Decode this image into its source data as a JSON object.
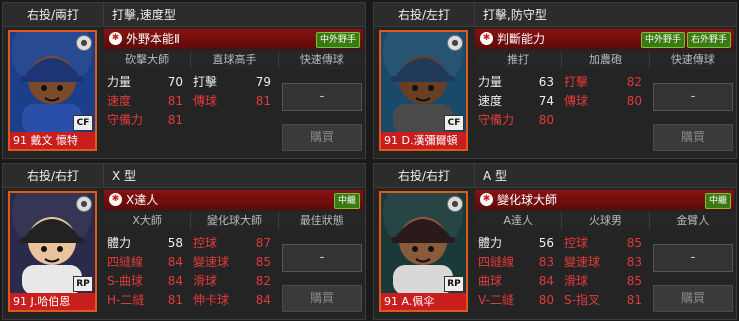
{
  "cards": [
    {
      "handedness": "右投/兩打",
      "player_type": "打擊,速度型",
      "portrait": {
        "number_name": "91 戴文 懷特",
        "position": "CF",
        "team_icon": "bat-ball-icon"
      },
      "ability": {
        "name": "外野本能Ⅱ",
        "icon": "red-star-icon",
        "position_badges": [
          "中外野手"
        ]
      },
      "sub_skills": [
        "砍擊大師",
        "直球高手",
        "快速傳球"
      ],
      "stats": [
        {
          "k1": "力量",
          "v1": "70",
          "k2": "打擊",
          "v2": "79",
          "c1": "w",
          "c2": "w"
        },
        {
          "k1": "速度",
          "v1": "81",
          "k2": "傳球",
          "v2": "81",
          "c1": "r",
          "c2": "r"
        },
        {
          "k1": "守備力",
          "v1": "81",
          "k2": "",
          "v2": "",
          "c1": "r",
          "c2": "r"
        }
      ],
      "slot_value": "-",
      "buy_label": "購買"
    },
    {
      "handedness": "右投/左打",
      "player_type": "打擊,防守型",
      "portrait": {
        "number_name": "91 D.漢彌爾頓",
        "position": "CF",
        "team_icon": "snowflake-icon"
      },
      "ability": {
        "name": "判斷能力",
        "icon": "blue-eye-icon",
        "position_badges": [
          "中外野手",
          "右外野手"
        ]
      },
      "sub_skills": [
        "推打",
        "加農砲",
        "快速傳球"
      ],
      "stats": [
        {
          "k1": "力量",
          "v1": "63",
          "k2": "打擊",
          "v2": "82",
          "c1": "w",
          "c2": "r"
        },
        {
          "k1": "速度",
          "v1": "74",
          "k2": "傳球",
          "v2": "80",
          "c1": "w",
          "c2": "r"
        },
        {
          "k1": "守備力",
          "v1": "80",
          "k2": "",
          "v2": "",
          "c1": "r",
          "c2": "r"
        }
      ],
      "slot_value": "-",
      "buy_label": "購買"
    },
    {
      "handedness": "右投/右打",
      "player_type": "X 型",
      "portrait": {
        "number_name": "91 J.哈伯恩",
        "position": "RP",
        "team_icon": "bat-ball-icon"
      },
      "ability": {
        "name": "X達人",
        "icon": "blue-x-icon",
        "position_badges": [
          "中繼"
        ]
      },
      "sub_skills": [
        "X大師",
        "變化球大師",
        "最佳狀態"
      ],
      "stats": [
        {
          "k1": "體力",
          "v1": "58",
          "k2": "控球",
          "v2": "87",
          "c1": "w",
          "c2": "r"
        },
        {
          "k1": "四縫線",
          "v1": "84",
          "k2": "變速球",
          "v2": "85",
          "c1": "r",
          "c2": "r"
        },
        {
          "k1": "S-曲球",
          "v1": "84",
          "k2": "滑球",
          "v2": "82",
          "c1": "r",
          "c2": "r"
        },
        {
          "k1": "H-二縫",
          "v1": "81",
          "k2": "伸卡球",
          "v2": "84",
          "c1": "r",
          "c2": "r"
        }
      ],
      "slot_value": "-",
      "buy_label": "購買"
    },
    {
      "handedness": "右投/右打",
      "player_type": "A 型",
      "portrait": {
        "number_name": "91 A.佩伞",
        "position": "RP",
        "team_icon": "red-logo-icon"
      },
      "ability": {
        "name": "變化球大師",
        "icon": "red-star-icon",
        "position_badges": [
          "中繼"
        ]
      },
      "sub_skills": [
        "A達人",
        "火球男",
        "金臂人"
      ],
      "stats": [
        {
          "k1": "體力",
          "v1": "56",
          "k2": "控球",
          "v2": "85",
          "c1": "w",
          "c2": "r"
        },
        {
          "k1": "四縫線",
          "v1": "83",
          "k2": "變速球",
          "v2": "83",
          "c1": "r",
          "c2": "r"
        },
        {
          "k1": "曲球",
          "v1": "84",
          "k2": "滑球",
          "v2": "85",
          "c1": "r",
          "c2": "r"
        },
        {
          "k1": "V-二縫",
          "v1": "80",
          "k2": "S-指叉",
          "v2": "81",
          "c1": "r",
          "c2": "r"
        }
      ],
      "slot_value": "-",
      "buy_label": "購買"
    }
  ],
  "colors": {
    "accent_red": "#e23a3a",
    "ability_bg": "#8a1212",
    "portrait_border": "#e0581c",
    "badge_green": "#3a7a12"
  }
}
